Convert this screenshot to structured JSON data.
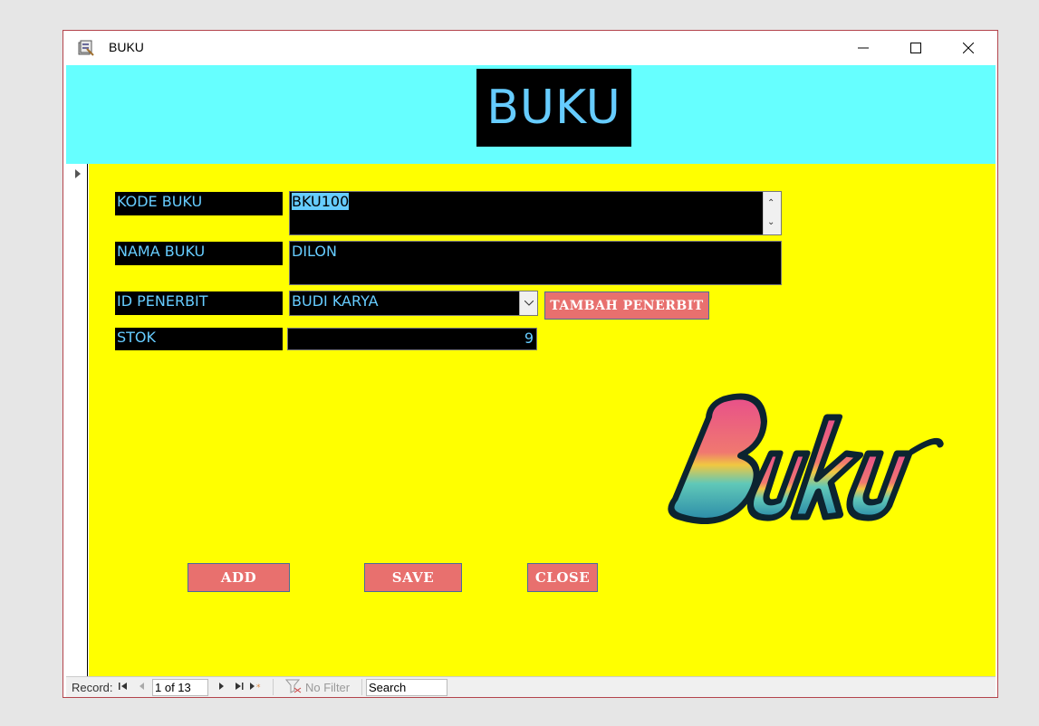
{
  "window": {
    "title": "BUKU"
  },
  "header": {
    "title": "BUKU"
  },
  "form": {
    "kode_buku": {
      "label": "KODE BUKU",
      "value": "BKU100"
    },
    "nama_buku": {
      "label": "NAMA BUKU",
      "value": "DILON"
    },
    "id_penerbit": {
      "label": "ID PENERBIT",
      "value": "BUDI KARYA"
    },
    "stok": {
      "label": "STOK",
      "value": "9"
    },
    "tambah_penerbit": "TAMBAH PENERBIT"
  },
  "buttons": {
    "add": "ADD",
    "save": "SAVE",
    "close": "CLOSE"
  },
  "logo": {
    "text": "Buku"
  },
  "navbar": {
    "record_label": "Record:",
    "record_position": "1 of 13",
    "filter": "No Filter",
    "search": "Search"
  },
  "colors": {
    "header_bg": "#66ffff",
    "detail_bg": "#ffff00",
    "field_bg": "#000000",
    "field_text": "#66ccff",
    "button_bg": "#e8706e"
  }
}
